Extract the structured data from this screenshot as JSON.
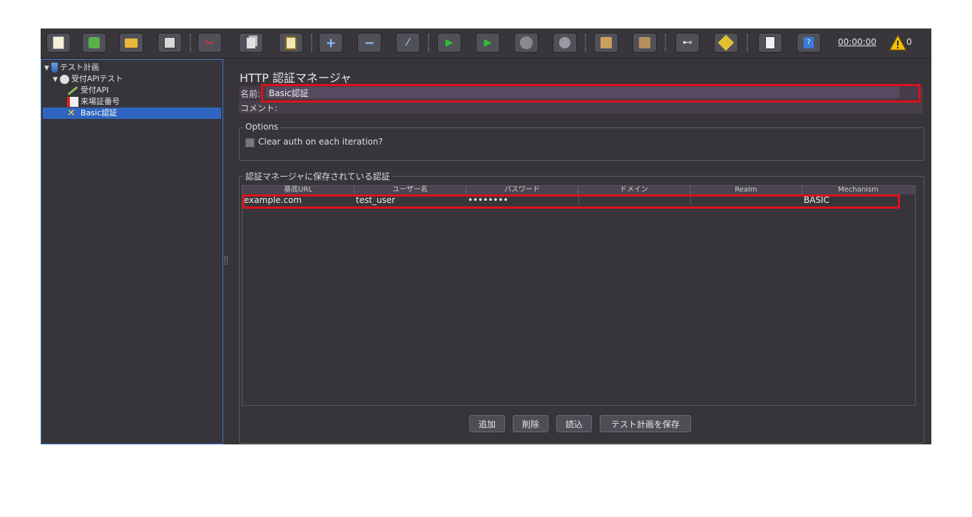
{
  "toolbar": {
    "timer": "00:00:00",
    "warning_count": "0"
  },
  "tree": {
    "items": [
      {
        "label": "テスト計画"
      },
      {
        "label": "受付APIテスト"
      },
      {
        "label": "受付API"
      },
      {
        "label": "来場証番号"
      },
      {
        "label": "Basic認証"
      }
    ]
  },
  "panel": {
    "title": "HTTP 認証マネージャ",
    "name_label": "名前:",
    "name_value": "Basic認証",
    "comment_label": "コメント:",
    "options_title": "Options",
    "clear_auth_label": "Clear auth on each iteration?",
    "auth_group_title": "認証マネージャに保存されている認証",
    "table": {
      "headers": [
        "基底URL",
        "ユーザー名",
        "パスワード",
        "ドメイン",
        "Realm",
        "Mechanism"
      ],
      "rows": [
        [
          "example.com",
          "test_user",
          "••••••••",
          "",
          "",
          "BASIC"
        ]
      ]
    },
    "buttons": {
      "add": "追加",
      "delete": "削除",
      "load": "読込",
      "save": "テスト計画を保存"
    }
  },
  "colors": {
    "background": "#38353a",
    "selection": "#2f65c0",
    "highlight_box": "#e0101a",
    "name_row": "#463c4a"
  }
}
